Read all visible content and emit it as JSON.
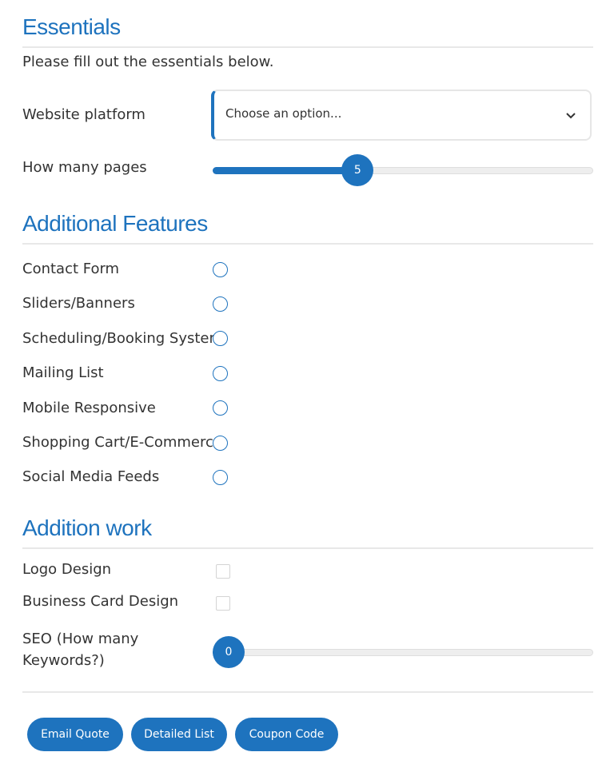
{
  "essentials": {
    "title": "Essentials",
    "intro": "Please fill out the essentials below.",
    "platform_label": "Website platform",
    "platform_value": "Choose an option...",
    "pages_label": "How many pages",
    "pages_value": "5",
    "pages_fraction": 0.37
  },
  "features": {
    "title": "Additional Features",
    "items": [
      {
        "label": "Contact Form"
      },
      {
        "label": "Sliders/Banners"
      },
      {
        "label": "Scheduling/Booking System"
      },
      {
        "label": "Mailing List"
      },
      {
        "label": "Mobile Responsive"
      },
      {
        "label": "Shopping Cart/E-Commerce"
      },
      {
        "label": "Social Media Feeds"
      }
    ]
  },
  "work": {
    "title": "Addition work",
    "logo_label": "Logo Design",
    "card_label": "Business Card Design",
    "seo_label_line1": "SEO (How many",
    "seo_label_line2": "Keywords?)",
    "seo_value": "0",
    "seo_fraction": 0
  },
  "buttons": {
    "email": "Email Quote",
    "detailed": "Detailed List",
    "coupon": "Coupon Code"
  },
  "colors": {
    "accent": "#1e73be",
    "text": "#333333"
  }
}
